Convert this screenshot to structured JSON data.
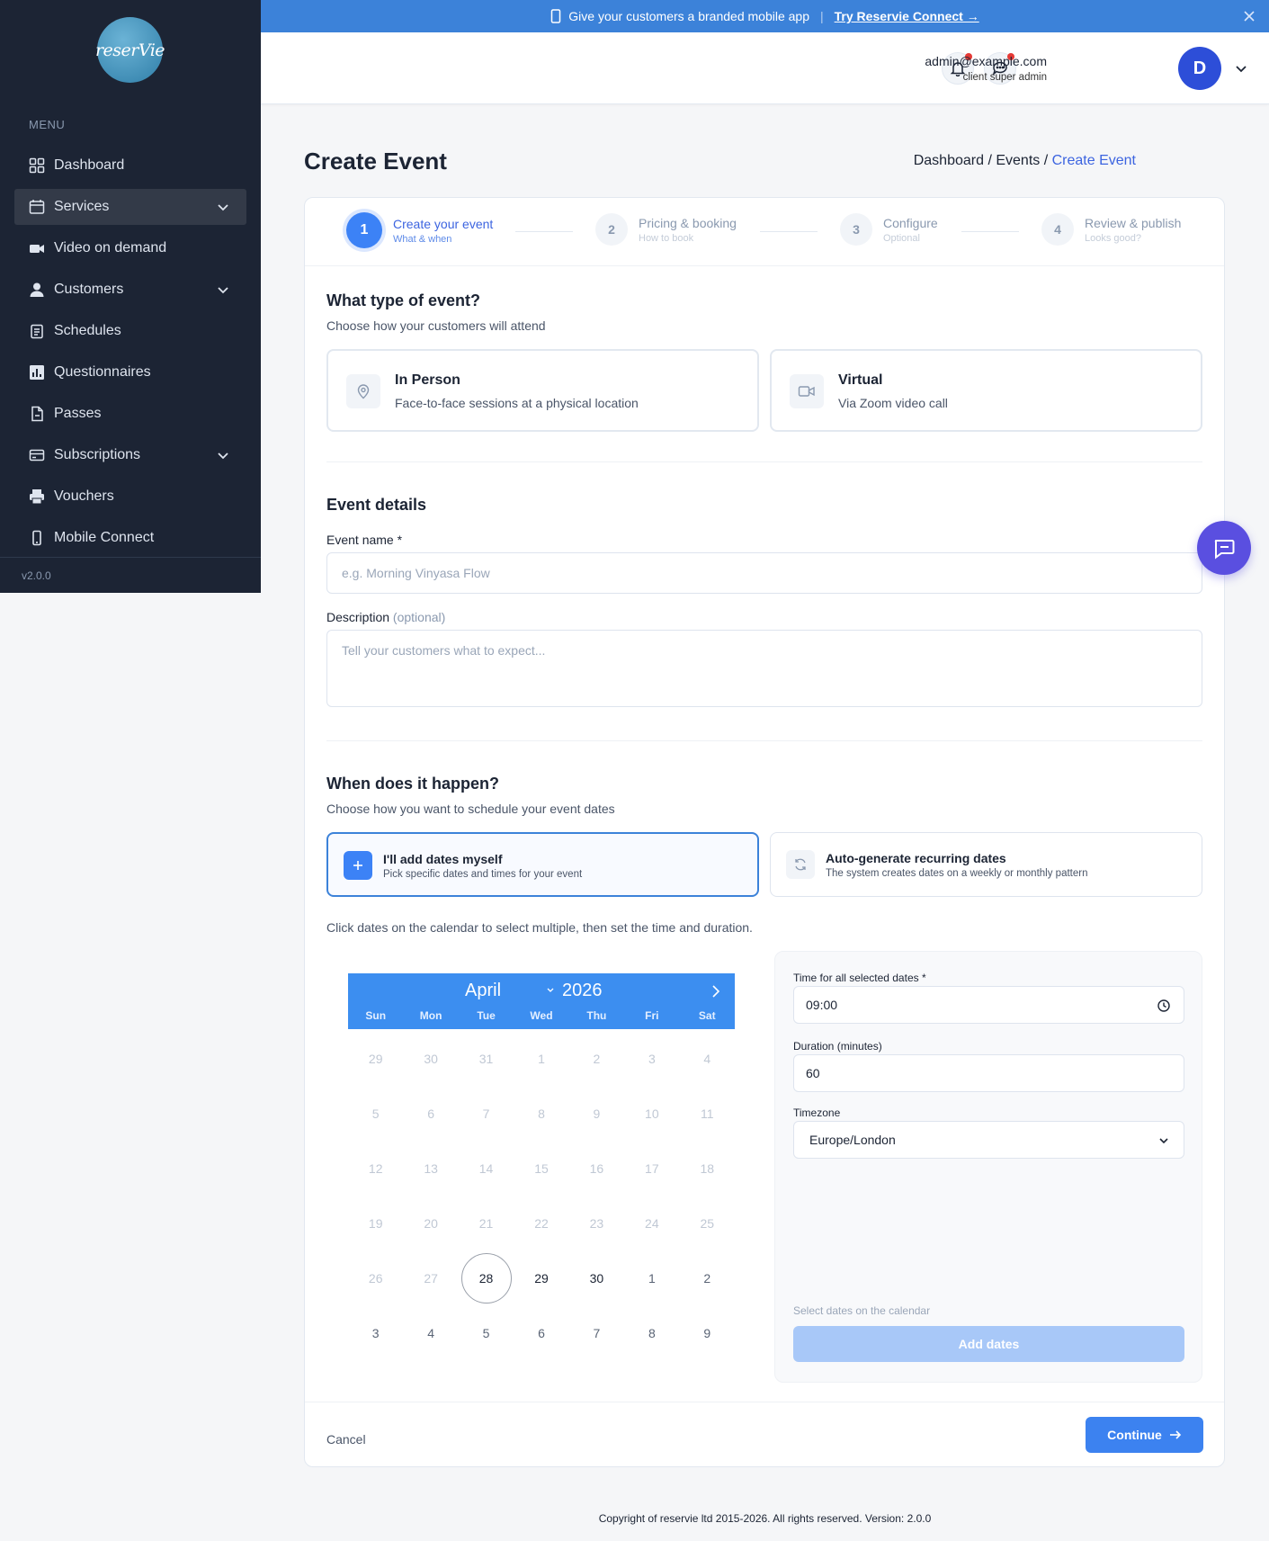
{
  "brand": {
    "logo_text": "reserVie"
  },
  "sidebar": {
    "menu_label": "MENU",
    "items": [
      {
        "label": "Dashboard",
        "icon": "grid-icon"
      },
      {
        "label": "Services",
        "icon": "calendar-card-icon",
        "active": true,
        "has_submenu": true
      },
      {
        "label": "Video on demand",
        "icon": "video-icon"
      },
      {
        "label": "Customers",
        "icon": "user-icon",
        "has_submenu": true
      },
      {
        "label": "Schedules",
        "icon": "clipboard-icon"
      },
      {
        "label": "Questionnaires",
        "icon": "bar-chart-icon"
      },
      {
        "label": "Passes",
        "icon": "document-icon"
      },
      {
        "label": "Subscriptions",
        "icon": "card-icon",
        "has_submenu": true
      },
      {
        "label": "Vouchers",
        "icon": "printer-icon"
      },
      {
        "label": "Mobile Connect",
        "icon": "phone-icon"
      }
    ],
    "version": "v2.0.0"
  },
  "banner": {
    "text": "Give your customers a branded mobile app",
    "separator": "|",
    "link": "Try Reservie Connect →"
  },
  "header": {
    "email": "admin@example.com",
    "role": "client super admin",
    "avatar_initial": "D"
  },
  "page": {
    "title": "Create Event",
    "breadcrumb": {
      "b1": "Dashboard /",
      "b2": "Events /",
      "current": "Create Event"
    }
  },
  "stepper": [
    {
      "num": "1",
      "title": "Create your event",
      "sub": "What & when",
      "active": true
    },
    {
      "num": "2",
      "title": "Pricing & booking",
      "sub": "How to book"
    },
    {
      "num": "3",
      "title": "Configure",
      "sub": "Optional"
    },
    {
      "num": "4",
      "title": "Review & publish",
      "sub": "Looks good?"
    }
  ],
  "event_type": {
    "title": "What type of event?",
    "subtitle": "Choose how your customers will attend",
    "options": [
      {
        "title": "In Person",
        "sub": "Face-to-face sessions at a physical location",
        "icon": "location-pin-icon"
      },
      {
        "title": "Virtual",
        "sub": "Via Zoom video call",
        "icon": "video-camera-icon"
      }
    ]
  },
  "details": {
    "title": "Event details",
    "name_label": "Event name *",
    "name_placeholder": "e.g. Morning Vinyasa Flow",
    "desc_label": "Description",
    "desc_optional": "(optional)",
    "desc_placeholder": "Tell your customers what to expect..."
  },
  "schedule": {
    "title": "When does it happen?",
    "subtitle": "Choose how you want to schedule your event dates",
    "modes": [
      {
        "title": "I'll add dates myself",
        "sub": "Pick specific dates and times for your event",
        "selected": true,
        "icon": "plus-icon"
      },
      {
        "title": "Auto-generate recurring dates",
        "sub": "The system creates dates on a weekly or monthly pattern",
        "icon": "refresh-icon"
      }
    ],
    "hint": "Click dates on the calendar to select multiple, then set the time and duration."
  },
  "calendar": {
    "month": "April",
    "year": "2026",
    "weekdays": [
      "Sun",
      "Mon",
      "Tue",
      "Wed",
      "Thu",
      "Fri",
      "Sat"
    ],
    "weeks": [
      [
        "29",
        "30",
        "31",
        "1",
        "2",
        "3",
        "4"
      ],
      [
        "5",
        "6",
        "7",
        "8",
        "9",
        "10",
        "11"
      ],
      [
        "12",
        "13",
        "14",
        "15",
        "16",
        "17",
        "18"
      ],
      [
        "19",
        "20",
        "21",
        "22",
        "23",
        "24",
        "25"
      ],
      [
        "26",
        "27",
        "28",
        "29",
        "30",
        "1",
        "2"
      ],
      [
        "3",
        "4",
        "5",
        "6",
        "7",
        "8",
        "9"
      ]
    ],
    "today": "28"
  },
  "panel": {
    "time_label": "Time for all selected dates *",
    "time_value": "09:00",
    "duration_label": "Duration (minutes)",
    "duration_value": "60",
    "tz_label": "Timezone",
    "tz_value": "Europe/London",
    "hint": "Select dates on the calendar",
    "add_button": "Add dates"
  },
  "footer": {
    "cancel": "Cancel",
    "continue": "Continue",
    "copyright": "Copyright of reservie ltd 2015-2026. All rights reserved. Version: 2.0.0"
  }
}
